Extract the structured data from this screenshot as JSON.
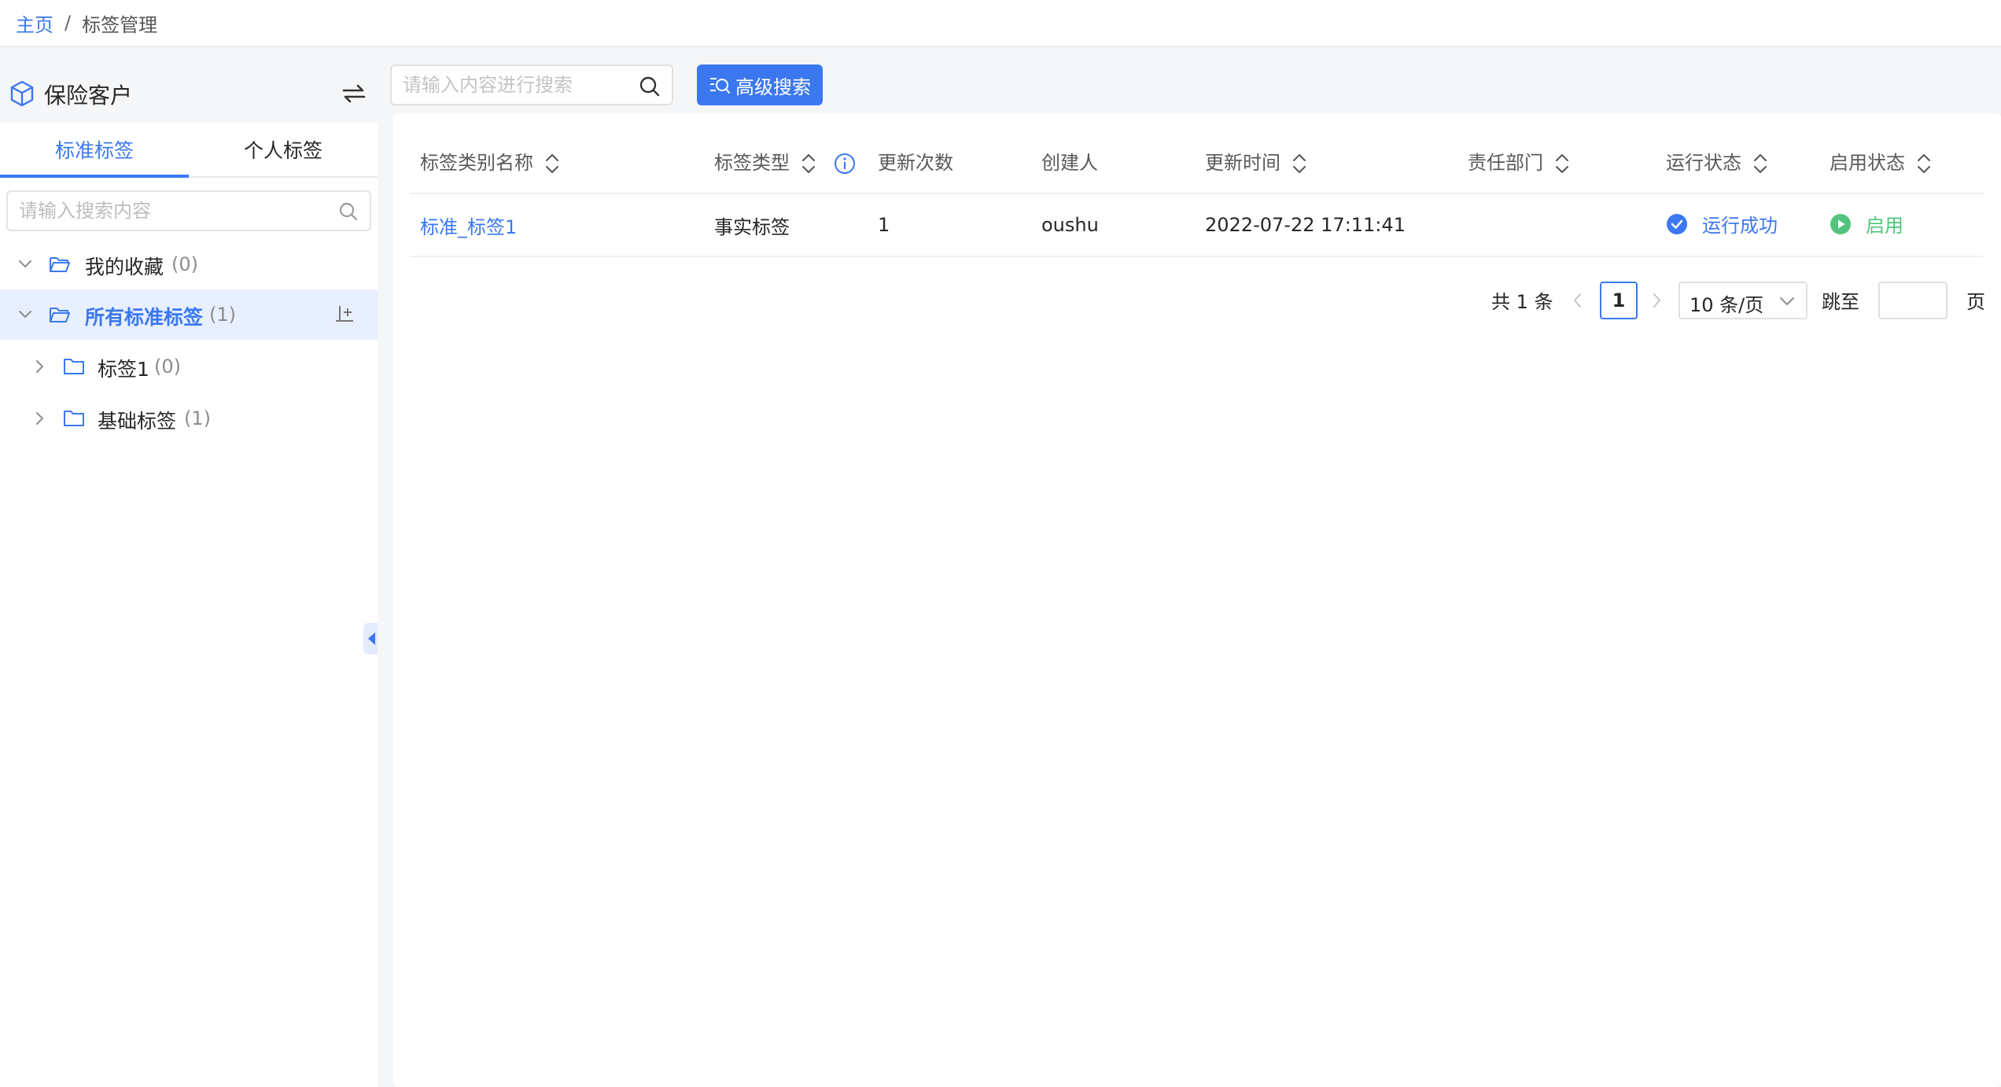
{
  "breadcrumb": {
    "home": "主页",
    "separator": "/",
    "current": "标签管理"
  },
  "sidebar": {
    "title": "保险客户",
    "tabs": [
      {
        "label": "标准标签",
        "active": true
      },
      {
        "label": "个人标签",
        "active": false
      }
    ],
    "search_placeholder": "请输入搜索内容",
    "tree": [
      {
        "name": "我的收藏",
        "count": "(0)",
        "expanded": true,
        "selected": false,
        "level": 0
      },
      {
        "name": "所有标准标签",
        "count": "(1)",
        "expanded": true,
        "selected": true,
        "level": 0
      },
      {
        "name": "标签1",
        "count": "(0)",
        "expanded": false,
        "selected": false,
        "level": 1
      },
      {
        "name": "基础标签",
        "count": "(1)",
        "expanded": false,
        "selected": false,
        "level": 1
      }
    ]
  },
  "toolbar": {
    "search_placeholder": "请输入内容进行搜索",
    "advanced_search": "高级搜索"
  },
  "table": {
    "columns": [
      "标签类别名称",
      "标签类型",
      "更新次数",
      "创建人",
      "更新时间",
      "责任部门",
      "运行状态",
      "启用状态"
    ],
    "rows": [
      {
        "name": "标准_标签1",
        "type": "事实标签",
        "update_count": "1",
        "creator": "oushu",
        "update_time": "2022-07-22 17:11:41",
        "department": "",
        "run_status": "运行成功",
        "enable_status": "启用"
      }
    ]
  },
  "pagination": {
    "total": "共 1 条",
    "current_page": "1",
    "page_size": "10 条/页",
    "jump_label": "跳至",
    "page_label": "页"
  },
  "colors": {
    "primary": "#3b78f0",
    "success": "#52c47d",
    "selected_bg": "#e8efff"
  }
}
